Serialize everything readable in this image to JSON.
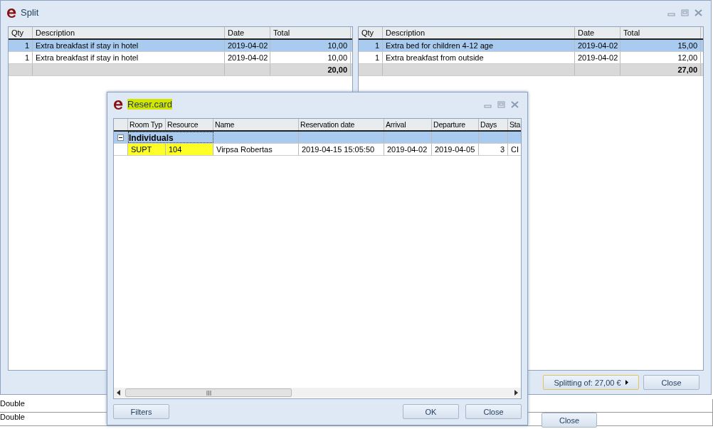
{
  "background": {
    "rows": [
      "Double",
      "Double"
    ],
    "button": "Close"
  },
  "split_window": {
    "title": "Split",
    "left_table": {
      "columns": [
        "Qty",
        "Description",
        "Date",
        "Total"
      ],
      "rows": [
        {
          "qty": "1",
          "description": "Extra breakfast if stay in hotel",
          "date": "2019-04-02",
          "total": "10,00",
          "selected": true
        },
        {
          "qty": "1",
          "description": "Extra breakfast if stay in hotel",
          "date": "2019-04-02",
          "total": "10,00",
          "selected": false
        }
      ],
      "sum": "20,00"
    },
    "right_table": {
      "columns": [
        "Qty",
        "Description",
        "Date",
        "Total"
      ],
      "rows": [
        {
          "qty": "1",
          "description": "Extra bed for children 4-12 age",
          "date": "2019-04-02",
          "total": "15,00",
          "selected": true
        },
        {
          "qty": "1",
          "description": "Extra breakfast from outside",
          "date": "2019-04-02",
          "total": "12,00",
          "selected": false
        }
      ],
      "sum": "27,00"
    },
    "splitting_button": "Splitting of: 27,00 €",
    "close_button": "Close"
  },
  "reservation_window": {
    "title": "Reser.card",
    "title_highlighted": true,
    "columns": [
      "Room Typ",
      "Resource",
      "Name",
      "Reservation date",
      "Arrival",
      "Departure",
      "Days",
      "Sta"
    ],
    "groups": [
      {
        "label": "Individuals",
        "expanded": true,
        "selected": true,
        "rows": [
          {
            "cells": [
              {
                "text": "SUPT",
                "highlighted": true
              },
              {
                "text": "104",
                "highlighted": true
              },
              {
                "text": "Virpsa Robertas",
                "highlighted": false
              },
              {
                "text": "2019-04-15 15:05:50",
                "highlighted": false
              },
              {
                "text": "2019-04-02",
                "highlighted": false
              },
              {
                "text": "2019-04-05",
                "highlighted": false
              },
              {
                "text": "3",
                "highlighted": false
              },
              {
                "text": "CI",
                "highlighted": false
              }
            ]
          }
        ]
      }
    ],
    "buttons": [
      "Filters",
      "OK",
      "Close"
    ]
  }
}
